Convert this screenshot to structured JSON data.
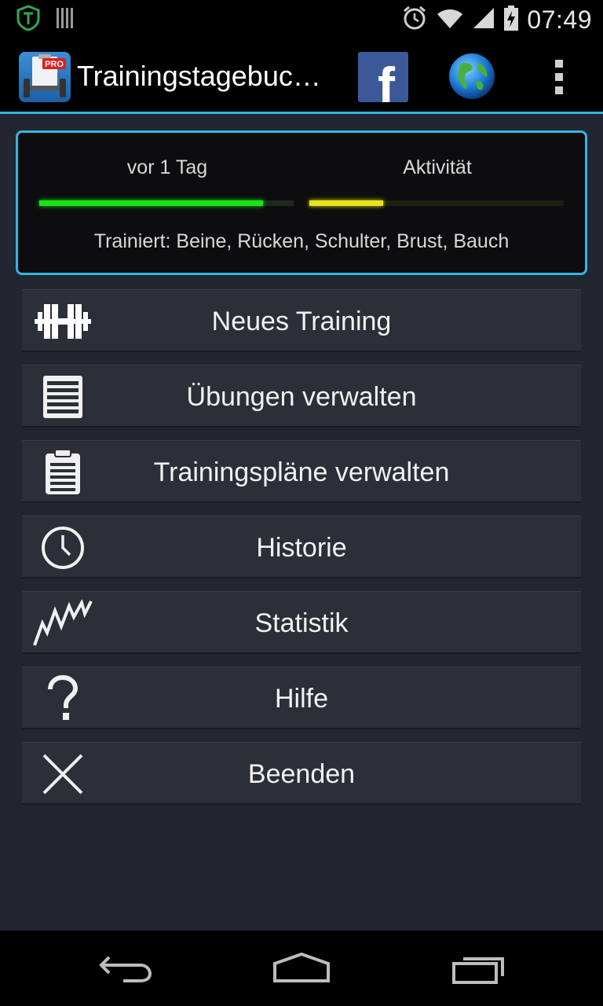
{
  "status_bar": {
    "time": "07:49",
    "icons": [
      "shield-app-icon",
      "barcode-icon",
      "alarm-icon",
      "wifi-icon",
      "signal-icon",
      "battery-icon"
    ]
  },
  "action_bar": {
    "title": "Trainingstagebuc…",
    "app_icon_badge": "PRO",
    "facebook_glyph": "f",
    "icons": [
      "app-icon",
      "facebook-icon",
      "globe-icon",
      "overflow-menu-icon"
    ]
  },
  "status_panel": {
    "last_training_label": "vor 1 Tag",
    "activity_label": "Aktivität",
    "last_training_progress": 0.88,
    "activity_progress": 0.29,
    "trained_text": "Trainiert: Beine, Rücken, Schulter, Brust, Bauch",
    "colors": {
      "last_training_bar": "#19e619",
      "activity_bar": "#e6e619",
      "border": "#33b5e5"
    }
  },
  "menu": {
    "items": [
      {
        "label": "Neues Training",
        "icon": "dumbbell-icon"
      },
      {
        "label": "Übungen verwalten",
        "icon": "list-icon"
      },
      {
        "label": "Trainingspläne verwalten",
        "icon": "clipboard-icon"
      },
      {
        "label": "Historie",
        "icon": "clock-icon"
      },
      {
        "label": "Statistik",
        "icon": "chart-icon"
      },
      {
        "label": "Hilfe",
        "icon": "help-icon"
      },
      {
        "label": "Beenden",
        "icon": "close-icon"
      }
    ]
  },
  "nav_bar": {
    "icons": [
      "back-icon",
      "home-icon",
      "recents-icon"
    ]
  }
}
